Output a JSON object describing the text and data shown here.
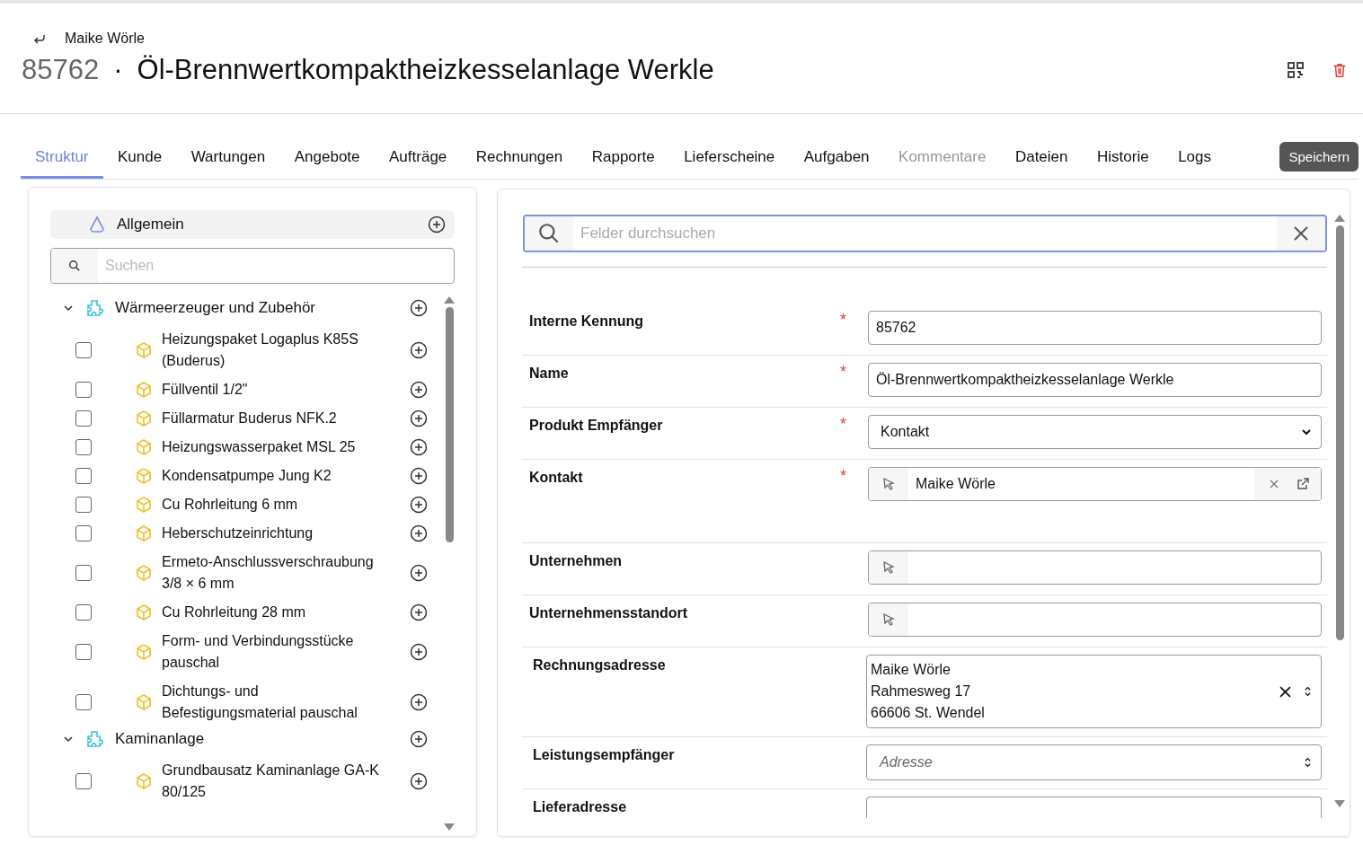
{
  "header": {
    "back_label": "Maike Wörle",
    "number": "85762",
    "separator": "·",
    "title": "Öl-Brennwertkompaktheizkesselanlage Werkle"
  },
  "tabs": [
    {
      "label": "Struktur",
      "selected": true,
      "disabled": false
    },
    {
      "label": "Kunde",
      "selected": false,
      "disabled": false
    },
    {
      "label": "Wartungen",
      "selected": false,
      "disabled": false
    },
    {
      "label": "Angebote",
      "selected": false,
      "disabled": false
    },
    {
      "label": "Aufträge",
      "selected": false,
      "disabled": false
    },
    {
      "label": "Rechnungen",
      "selected": false,
      "disabled": false
    },
    {
      "label": "Rapporte",
      "selected": false,
      "disabled": false
    },
    {
      "label": "Lieferscheine",
      "selected": false,
      "disabled": false
    },
    {
      "label": "Aufgaben",
      "selected": false,
      "disabled": false
    },
    {
      "label": "Kommentare",
      "selected": false,
      "disabled": true
    },
    {
      "label": "Dateien",
      "selected": false,
      "disabled": false
    },
    {
      "label": "Historie",
      "selected": false,
      "disabled": false
    },
    {
      "label": "Logs",
      "selected": false,
      "disabled": false
    }
  ],
  "save_button": "Speichern",
  "structure": {
    "root": "Allgemein",
    "search": {
      "placeholder": "Suchen"
    },
    "groups": [
      {
        "label": "Wärmeerzeuger und Zubehör",
        "expanded": true,
        "children": [
          {
            "label": "Heizungspaket Logaplus K85S (Buderus)",
            "checked": false
          },
          {
            "label": "Füllventil 1/2\"",
            "checked": false
          },
          {
            "label": "Füllarmatur Buderus NFK.2",
            "checked": false
          },
          {
            "label": "Heizungswasserpaket MSL 25",
            "checked": false
          },
          {
            "label": "Kondensatpumpe Jung K2",
            "checked": false
          },
          {
            "label": "Cu Rohrleitung 6 mm",
            "checked": false
          },
          {
            "label": "Heberschutzeinrichtung",
            "checked": false
          },
          {
            "label": "Ermeto-Anschlussverschraubung 3/8 × 6 mm",
            "checked": false
          },
          {
            "label": "Cu Rohrleitung 28 mm",
            "checked": false
          },
          {
            "label": "Form- und Verbindungsstücke pauschal",
            "checked": false
          },
          {
            "label": "Dichtungs- und Befestigungsmaterial pauschal",
            "checked": false
          }
        ]
      },
      {
        "label": "Kaminanlage",
        "expanded": true,
        "children": [
          {
            "label": "Grundbausatz Kaminanlage GA-K 80/125",
            "checked": false
          }
        ]
      }
    ]
  },
  "form": {
    "search": {
      "placeholder": "Felder durchsuchen"
    },
    "fields": [
      {
        "label": "Interne Kennung",
        "required_mark": "*",
        "kind": "text",
        "value": "85762"
      },
      {
        "label": "Name",
        "required_mark": "*",
        "kind": "text",
        "value": "Öl-Brennwertkompaktheizkesselanlage Werkle"
      },
      {
        "label": "Produkt Empfänger",
        "required_mark": "*",
        "kind": "select",
        "value": "Kontakt"
      },
      {
        "label": "Kontakt",
        "required_mark": "*",
        "kind": "lookup",
        "value": "Maike Wörle"
      },
      {
        "label": "Unternehmen",
        "kind": "lookup"
      },
      {
        "label": "Unternehmensstandort",
        "kind": "lookup"
      },
      {
        "label": "Rechnungsadresse",
        "kind": "address",
        "lines": [
          "Maike Wörle",
          "Rahmesweg 17",
          "66606 St. Wendel"
        ]
      },
      {
        "label": "Leistungsempfänger",
        "kind": "address-select",
        "placeholder": "Adresse"
      },
      {
        "label": "Lieferadresse",
        "kind": "address-cut"
      }
    ]
  }
}
